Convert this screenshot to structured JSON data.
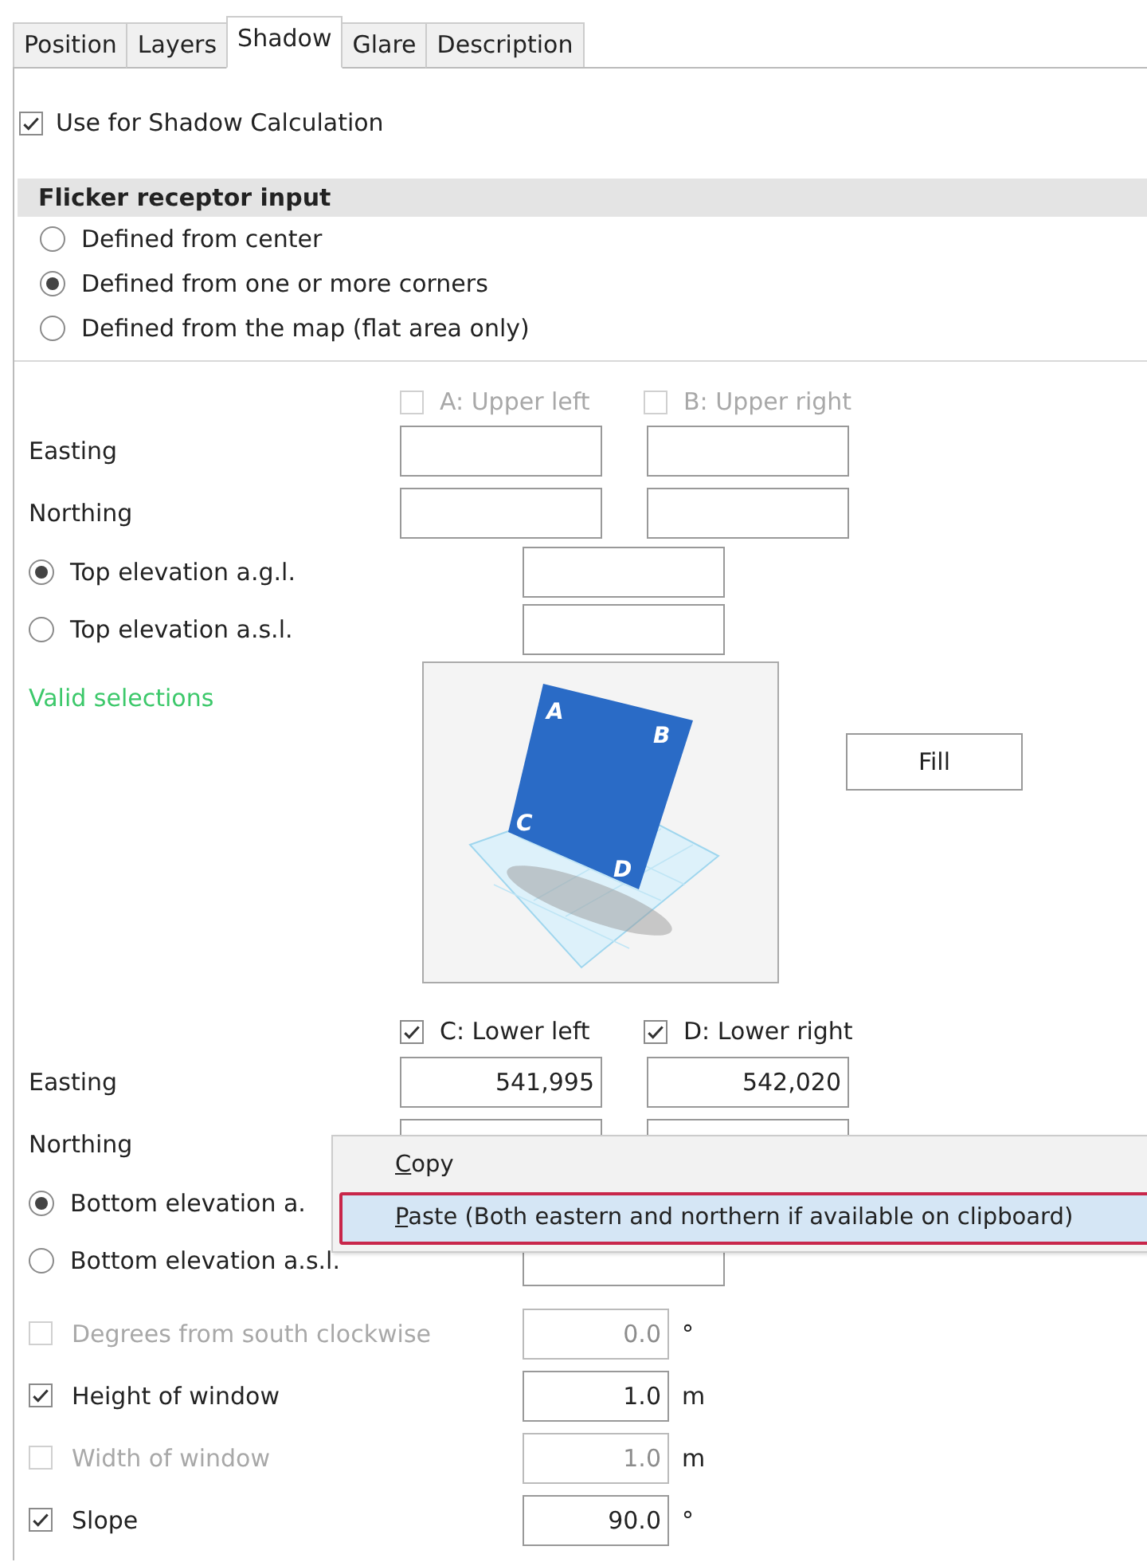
{
  "tabs": [
    {
      "label": "Position",
      "selected": false
    },
    {
      "label": "Layers",
      "selected": false
    },
    {
      "label": "Shadow",
      "selected": true
    },
    {
      "label": "Glare",
      "selected": false
    },
    {
      "label": "Description",
      "selected": false
    }
  ],
  "use_shadow": {
    "label": "Use for Shadow Calculation",
    "checked": true
  },
  "receptor": {
    "title": "Flicker receptor input",
    "options": [
      {
        "label": "Defined from center",
        "selected": false
      },
      {
        "label": "Defined from one or more corners",
        "selected": true
      },
      {
        "label": "Defined from the map (flat area only)",
        "selected": false
      }
    ]
  },
  "upper_corners": [
    {
      "label": "A: Upper left",
      "checked": false,
      "disabled": true
    },
    {
      "label": "B: Upper right",
      "checked": false,
      "disabled": true
    }
  ],
  "upper_rows": [
    {
      "label": "Easting"
    },
    {
      "label": "Northing"
    }
  ],
  "top_elevation": [
    {
      "label": "Top elevation a.g.l.",
      "selected": true
    },
    {
      "label": "Top elevation a.s.l.",
      "selected": false
    }
  ],
  "valid_selections": "Valid selections",
  "corner_labels": [
    "A",
    "B",
    "C",
    "D"
  ],
  "fill_button": "Fill",
  "lower_corners": [
    {
      "label": "C: Lower left",
      "checked": true,
      "disabled": false
    },
    {
      "label": "D: Lower right",
      "checked": true,
      "disabled": false
    }
  ],
  "lower_rows": [
    {
      "label": "Easting",
      "values": [
        "541,995",
        "542,020"
      ]
    },
    {
      "label": "Northing"
    }
  ],
  "bottom_elevation": [
    {
      "label": "Bottom elevation a.",
      "selected": true
    },
    {
      "label": "Bottom elevation a.s.l.",
      "selected": false
    }
  ],
  "params": [
    {
      "label": "Degrees from south clockwise",
      "checked": false,
      "disabled": true,
      "value": "0.0",
      "unit": "°"
    },
    {
      "label": "Height of window",
      "checked": true,
      "disabled": false,
      "value": "1.0",
      "unit": "m"
    },
    {
      "label": "Width of window",
      "checked": false,
      "disabled": true,
      "value": "1.0",
      "unit": "m"
    },
    {
      "label": "Slope",
      "checked": true,
      "disabled": false,
      "value": "90.0",
      "unit": "°"
    }
  ],
  "context_menu": {
    "items": [
      {
        "label": "Copy",
        "selected": false
      },
      {
        "label": "Paste (Both eastern and northern if available on clipboard)",
        "selected": true
      }
    ]
  }
}
